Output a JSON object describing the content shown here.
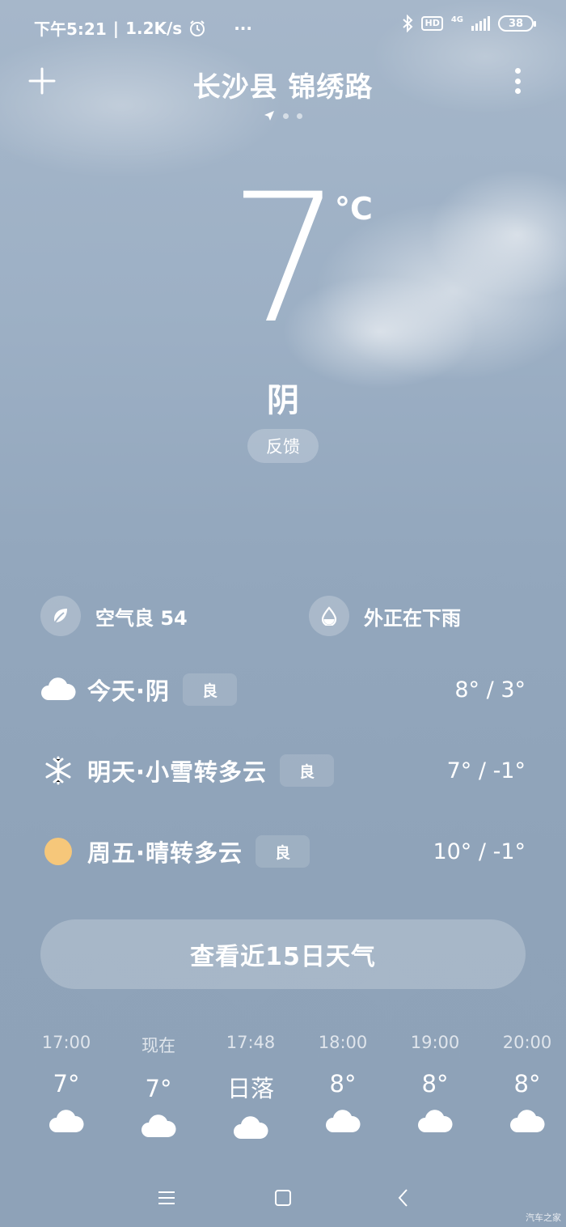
{
  "status_bar": {
    "time": "下午5:21",
    "speed": "1.2K/s",
    "more": "···",
    "network_type": "4G",
    "hd": "HD",
    "battery": "38"
  },
  "header": {
    "location": "长沙县 锦绣路"
  },
  "current": {
    "temperature": "7",
    "unit": "°C",
    "condition": "阴",
    "feedback_label": "反馈"
  },
  "info": {
    "air_quality": "空气良 54",
    "rain_notice": "外正在下雨"
  },
  "daily": [
    {
      "icon": "cloud-icon",
      "label": "今天·阴",
      "aqi": "良",
      "temp": "8° / 3°"
    },
    {
      "icon": "snowflake-icon",
      "label": "明天·小雪转多云",
      "aqi": "良",
      "temp": "7° / -1°"
    },
    {
      "icon": "sun-icon",
      "label": "周五·晴转多云",
      "aqi": "良",
      "temp": "10° / -1°"
    }
  ],
  "forecast_button": "查看近15日天气",
  "hourly": [
    {
      "time": "17:00",
      "temp": "7°",
      "icon": "cloud-icon"
    },
    {
      "time": "现在",
      "temp": "7°",
      "icon": "cloud-icon"
    },
    {
      "time": "17:48",
      "temp": "日落",
      "icon": "cloud-icon"
    },
    {
      "time": "18:00",
      "temp": "8°",
      "icon": "cloud-icon"
    },
    {
      "time": "19:00",
      "temp": "8°",
      "icon": "cloud-icon"
    },
    {
      "time": "20:00",
      "temp": "8°",
      "icon": "cloud-icon"
    }
  ],
  "watermark": "汽车之家",
  "colors": {
    "background_top": "#a6b7ca",
    "background_bottom": "#8ea2b8",
    "sun": "#f6c77a"
  }
}
